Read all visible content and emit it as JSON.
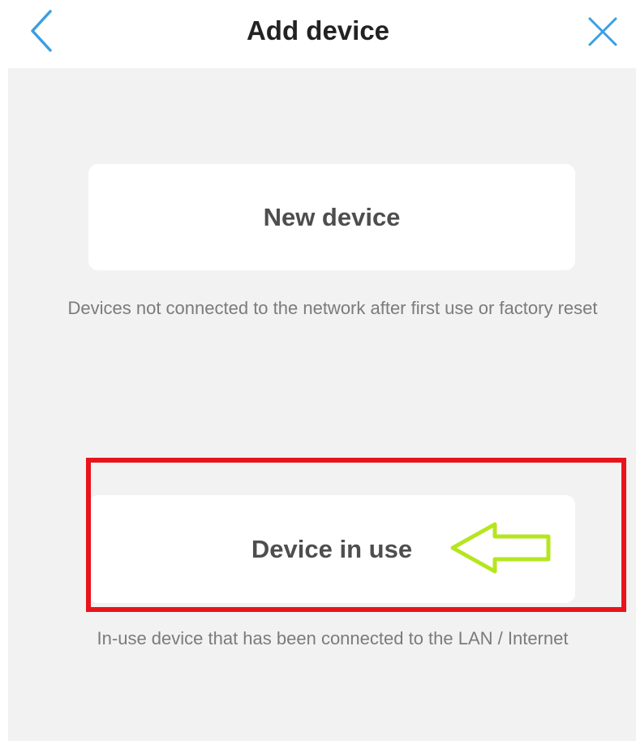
{
  "header": {
    "title": "Add device",
    "back_icon": "chevron-left-icon",
    "close_icon": "close-icon",
    "icon_color": "#3a9fe0"
  },
  "options": [
    {
      "label": "New device",
      "description": "Devices not connected to the network after first use or factory reset"
    },
    {
      "label": "Device in use",
      "description": "In-use device that has been connected to the LAN / Internet"
    }
  ],
  "annotation": {
    "highlight_color": "#e8141c",
    "arrow_color": "#b5e61d",
    "arrow_icon": "arrow-left-icon"
  }
}
